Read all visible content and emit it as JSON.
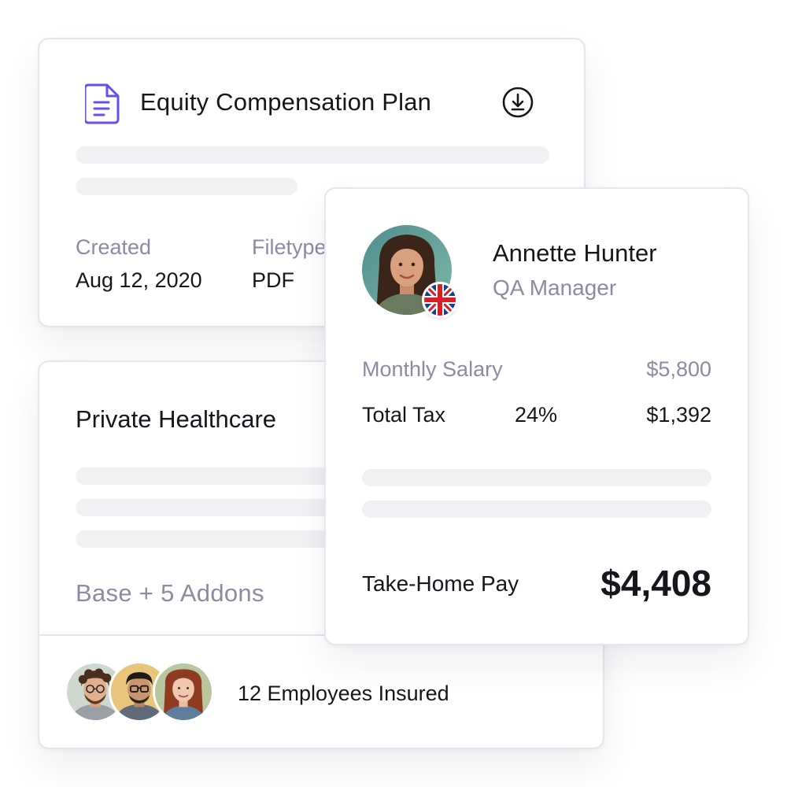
{
  "equity_card": {
    "title": "Equity Compensation Plan",
    "icon": "document-icon",
    "download_icon": "download-icon",
    "created_label": "Created",
    "created_value": "Aug 12, 2020",
    "filetype_label": "Filetype",
    "filetype_value": "PDF"
  },
  "healthcare_card": {
    "title": "Private Healthcare",
    "plan": "Base + 5 Addons",
    "insured_text": "12 Employees Insured"
  },
  "salary_card": {
    "name": "Annette Hunter",
    "role": "QA Manager",
    "flag": "uk-flag-icon",
    "monthly_salary_label": "Monthly Salary",
    "monthly_salary_value": "$5,800",
    "total_tax_label": "Total Tax",
    "total_tax_percent": "24%",
    "total_tax_value": "$1,392",
    "take_home_label": "Take-Home Pay",
    "take_home_value": "$4,408"
  },
  "colors": {
    "accent": "#6c4ee6",
    "muted_text": "#8b8ba3",
    "border": "#e6e6f0",
    "skeleton": "#f1f1f4"
  }
}
